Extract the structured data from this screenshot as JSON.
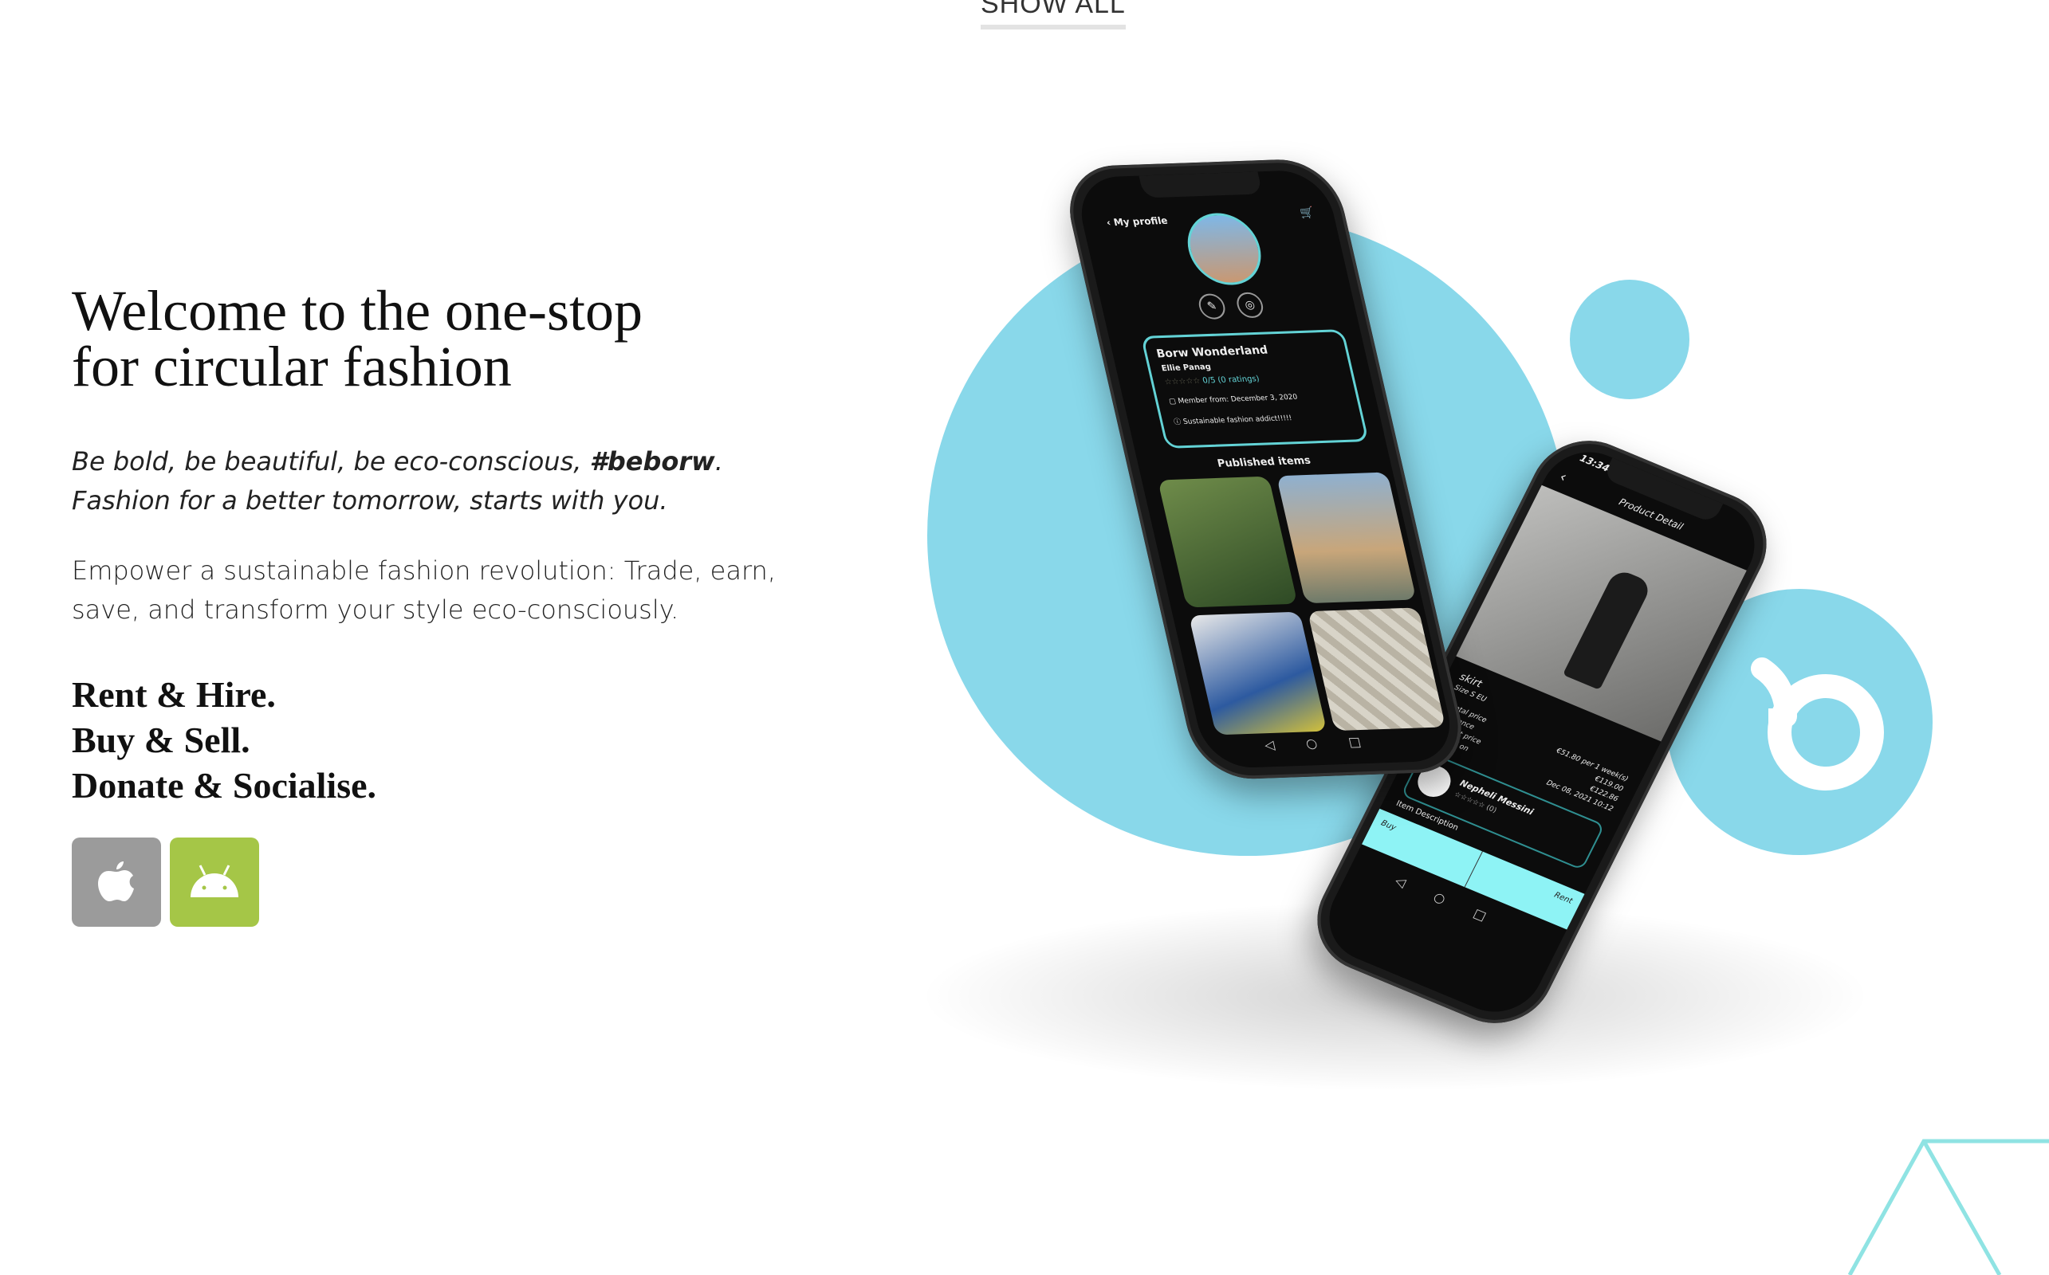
{
  "nav": {
    "show_all": "SHOW ALL"
  },
  "hero": {
    "title_line1": "Welcome to the one-stop",
    "title_line2": "for circular fashion",
    "tagline_line1_pre": "Be bold, be beautiful, be eco-conscious, ",
    "tagline_hashtag": "#beborw",
    "tagline_line1_post": ".",
    "tagline_line2": "Fashion for a better tomorrow, starts with you.",
    "empower_line1": "Empower a sustainable fashion revolution: Trade, earn,",
    "empower_line2": "save, and transform your style eco-consciously.",
    "actions": [
      "Rent & Hire.",
      "Buy & Sell.",
      "Donate & Socialise."
    ]
  },
  "stores": [
    {
      "name": "apple-icon",
      "color": "#9b9b9b"
    },
    {
      "name": "android-icon",
      "color": "#a5c647"
    }
  ],
  "colors": {
    "accent_blue": "#89d8ea",
    "teal": "#63d3d6",
    "android_green": "#a5c647"
  },
  "phone_profile": {
    "header": "My profile",
    "shop_name": "Borw Wonderland",
    "user_name": "Ellie Panag",
    "rating": "0/5 (0 ratings)",
    "member_since": "Member from: December 3, 2020",
    "bio": "Sustainable fashion addict!!!!!",
    "published_title": "Published items"
  },
  "phone_product": {
    "time": "13:34",
    "header": "Product Detail",
    "item_title": "skirt",
    "item_size": "Size S EU",
    "labels": [
      "Rental price",
      "Insurance",
      "Buy-out price",
      "Created on"
    ],
    "values": [
      "€51.80 per 1 week(s)",
      "€119.00",
      "€122.86",
      "Dec 08, 2021 10:12"
    ],
    "seller_name": "Nepheli Messini",
    "seller_reviews": "(0)",
    "description_label": "Item Description",
    "buy_label": "Buy",
    "rent_label": "Rent"
  }
}
